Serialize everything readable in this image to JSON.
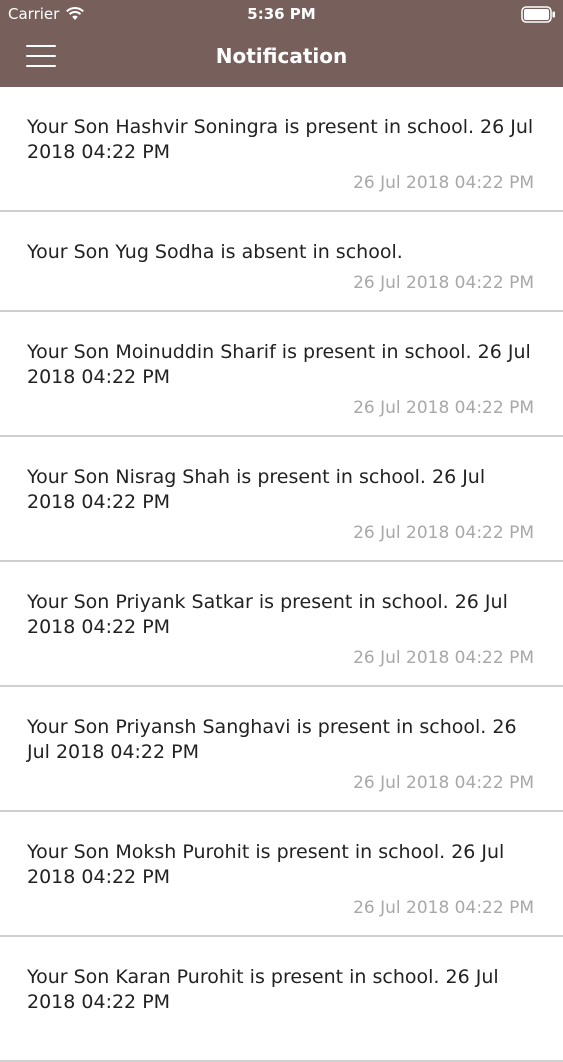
{
  "status_bar": {
    "carrier": "Carrier",
    "time": "5:36 PM"
  },
  "nav": {
    "title": "Notification"
  },
  "notifications": [
    {
      "message": "Your Son Hashvir Soningra is present in school. 26 Jul 2018 04:22 PM",
      "time": "26 Jul 2018 04:22 PM"
    },
    {
      "message": "Your Son Yug Sodha is absent in school.",
      "time": "26 Jul 2018 04:22 PM"
    },
    {
      "message": "Your Son Moinuddin Sharif is present in school. 26 Jul 2018 04:22 PM",
      "time": "26 Jul 2018 04:22 PM"
    },
    {
      "message": "Your Son Nisrag Shah is present in school. 26 Jul 2018 04:22 PM",
      "time": "26 Jul 2018 04:22 PM"
    },
    {
      "message": "Your Son Priyank Satkar is present in school. 26 Jul 2018 04:22 PM",
      "time": "26 Jul 2018 04:22 PM"
    },
    {
      "message": "Your Son Priyansh Sanghavi is present in school. 26 Jul 2018 04:22 PM",
      "time": "26 Jul 2018 04:22 PM"
    },
    {
      "message": "Your Son Moksh Purohit is present in school. 26 Jul 2018 04:22 PM",
      "time": "26 Jul 2018 04:22 PM"
    },
    {
      "message": "Your Son Karan Purohit is present in school. 26 Jul 2018 04:22 PM",
      "time": ""
    }
  ],
  "colors": {
    "header": "#77605c",
    "divider": "#cfcfcf",
    "timestamp": "#a8a8a8"
  },
  "icons": [
    "wifi-icon",
    "battery-icon",
    "menu-icon"
  ]
}
